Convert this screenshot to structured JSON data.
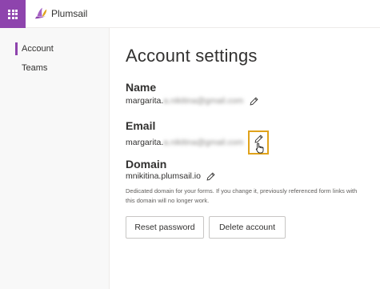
{
  "app": {
    "brand_name": "Plumsail",
    "accent_color": "#8e44ad",
    "highlight_color": "#e0a21b"
  },
  "sidebar": {
    "items": [
      {
        "label": "Account",
        "active": true
      },
      {
        "label": "Teams",
        "active": false
      }
    ]
  },
  "main": {
    "title": "Account settings",
    "name": {
      "label": "Name",
      "value_prefix": "margarita.",
      "value_hidden": "a.nikitina@gmail.com"
    },
    "email": {
      "label": "Email",
      "value_prefix": "margarita.",
      "value_hidden": "a.nikitina@gmail.com"
    },
    "domain": {
      "label": "Domain",
      "value": "mnikitina.plumsail.io",
      "hint": "Dedicated domain for your forms. If you change it, previously referenced form links with this domain will no longer work."
    },
    "buttons": {
      "reset_password": "Reset password",
      "delete_account": "Delete account"
    }
  },
  "icons": {
    "app_launcher": "waffle-icon",
    "logo": "plumsail-logo-icon",
    "edit": "pencil-icon",
    "cursor": "hand-pointer-icon"
  }
}
